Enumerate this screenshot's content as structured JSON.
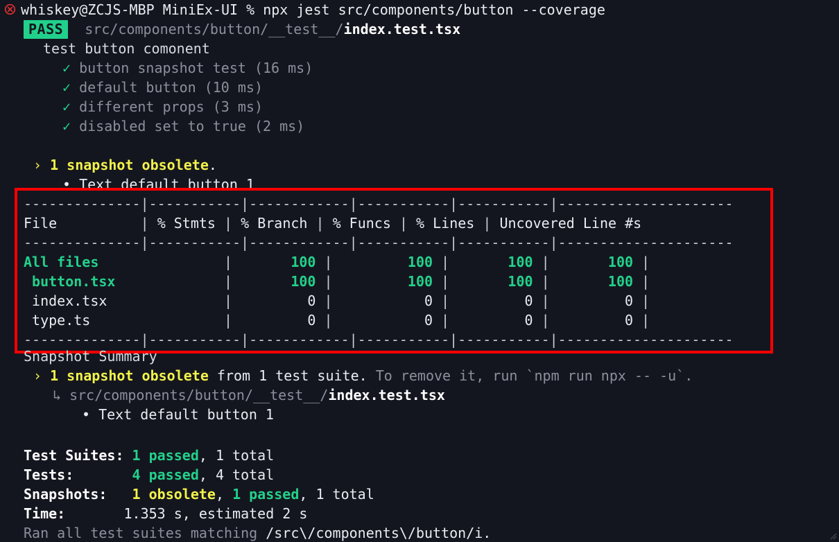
{
  "terminal": {
    "background": "#14161f",
    "foreground": "#d8dce3",
    "accent_green": "#23d18b",
    "accent_yellow": "#f2f24b",
    "highlight_red": "#fe0000",
    "icons": {
      "error": "error-circle-x-icon",
      "resize_grip": "resize-grip-icon"
    }
  },
  "prompt": {
    "user_host": "whiskey@ZCJS-MBP",
    "cwd": "MiniEx-UI",
    "symbol": "%",
    "command": "npx jest src/components/button --coverage"
  },
  "suite": {
    "status_badge": "PASS",
    "path_dim": "src/components/button/__test__/",
    "path_file": "index.test.tsx",
    "describe": "test button comonent",
    "check_glyph": "✓",
    "tests": [
      {
        "name": "button snapshot test",
        "duration": "(16 ms)"
      },
      {
        "name": "default button",
        "duration": "(10 ms)"
      },
      {
        "name": "different props",
        "duration": "(3 ms)"
      },
      {
        "name": "disabled set to true",
        "duration": "(2 ms)"
      }
    ]
  },
  "obsolete_notice": {
    "arrow": "›",
    "text_bold": "1 snapshot obsolete",
    "text_tail": ".",
    "bullet": "•",
    "bullet_text": "Text default button 1"
  },
  "coverage": {
    "columns": [
      "File",
      "% Stmts",
      "% Branch",
      "% Funcs",
      "% Lines",
      "Uncovered Line #s"
    ],
    "rows": [
      {
        "file": "All files",
        "indent": 0,
        "stmts": "100",
        "branch": "100",
        "funcs": "100",
        "lines": "100",
        "uncovered": "",
        "style": "green-bold"
      },
      {
        "file": "button.tsx",
        "indent": 1,
        "stmts": "100",
        "branch": "100",
        "funcs": "100",
        "lines": "100",
        "uncovered": "",
        "style": "green-bold"
      },
      {
        "file": "index.tsx",
        "indent": 1,
        "stmts": "0",
        "branch": "0",
        "funcs": "0",
        "lines": "0",
        "uncovered": "",
        "style": "plain"
      },
      {
        "file": "type.ts",
        "indent": 1,
        "stmts": "0",
        "branch": "0",
        "funcs": "0",
        "lines": "0",
        "uncovered": "",
        "style": "plain"
      }
    ],
    "divider_segments": [
      "--------------",
      "-----------",
      "------------",
      "-----------",
      "-----------",
      "---------------------"
    ]
  },
  "snapshot_summary": {
    "heading": "Snapshot Summary",
    "arrow": "›",
    "bold_text": "1 snapshot obsolete",
    "from_text": " from 1 test suite. ",
    "hint_text": "To remove it, run `npm run npx -- -u`.",
    "sub_arrow": "↳",
    "sub_path_dim": "src/components/button/__test__/",
    "sub_path_file": "index.test.tsx",
    "bullet": "•",
    "bullet_text": "Text default button 1"
  },
  "totals": {
    "rows": [
      {
        "label": "Test Suites:",
        "pad": " ",
        "green": "1 passed",
        "yellow": "",
        "rest": ", 1 total"
      },
      {
        "label": "Tests:",
        "pad": "       ",
        "green": "4 passed",
        "yellow": "",
        "rest": ", 4 total"
      },
      {
        "label": "Snapshots:",
        "pad": "   ",
        "green": "1 passed",
        "yellow": "1 obsolete",
        "rest": ", 1 total"
      },
      {
        "label": "Time:",
        "pad": "       ",
        "green": "",
        "yellow": "",
        "rest": "1.353 s, estimated 2 s"
      }
    ],
    "ran_all": "Ran all test suites matching /src\\/components\\/button/i."
  }
}
